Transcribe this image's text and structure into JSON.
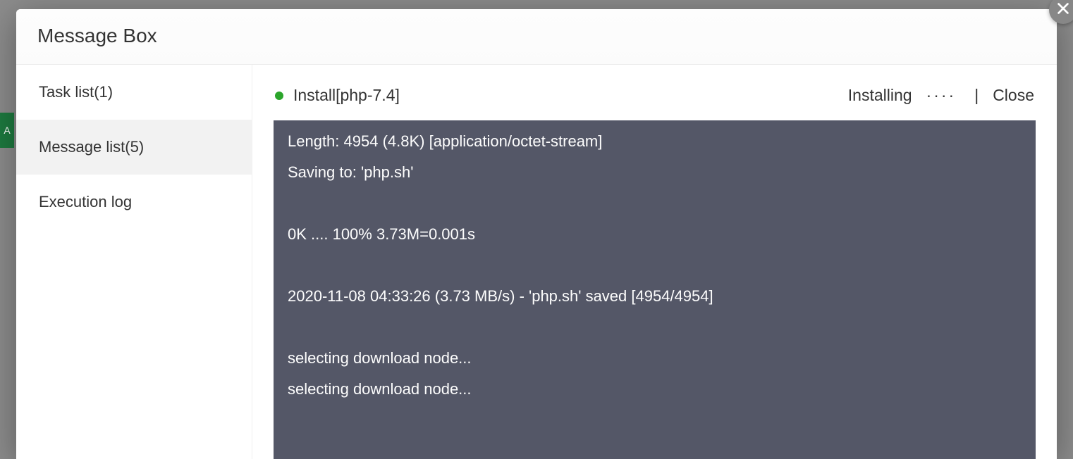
{
  "dialog": {
    "title": "Message Box"
  },
  "sidebar": {
    "items": [
      {
        "label": "Task list(1)",
        "active": false
      },
      {
        "label": "Message list(5)",
        "active": true
      },
      {
        "label": "Execution log",
        "active": false
      }
    ]
  },
  "task": {
    "title": "Install[php-7.4]",
    "status_label": "Installing",
    "progress_dots": "····",
    "separator": "|",
    "close_label": "Close",
    "status_color": "#2ba52b"
  },
  "console_lines": [
    "Length: 4954 (4.8K) [application/octet-stream]",
    "Saving to: 'php.sh'",
    "",
    "0K .... 100% 3.73M=0.001s",
    "",
    "2020-11-08 04:33:26 (3.73 MB/s) - 'php.sh' saved [4954/4954]",
    "",
    "selecting download node...",
    "selecting download node..."
  ],
  "bg_hint": "A"
}
